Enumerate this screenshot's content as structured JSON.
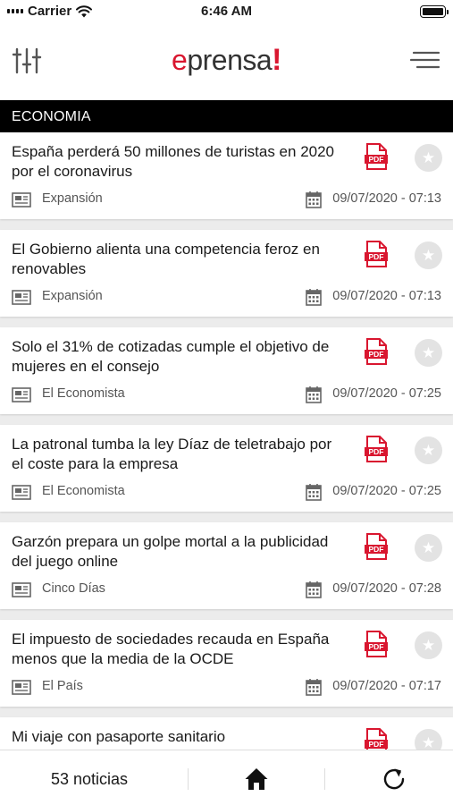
{
  "status_bar": {
    "carrier": "Carrier",
    "time": "6:46 AM"
  },
  "header": {
    "logo_e": "e",
    "logo_rest": "prensa",
    "logo_bang": "!"
  },
  "section": {
    "title": "ECONOMIA"
  },
  "news": [
    {
      "title": "España perderá 50 millones de turistas en 2020 por el coronavirus",
      "source": "Expansión",
      "datetime": "09/07/2020 - 07:13"
    },
    {
      "title": "El Gobierno alienta una competencia feroz en renovables",
      "source": "Expansión",
      "datetime": "09/07/2020 - 07:13"
    },
    {
      "title": "Solo el 31% de cotizadas cumple el objetivo de mujeres en el consejo",
      "source": "El Economista",
      "datetime": "09/07/2020 - 07:25"
    },
    {
      "title": "La patronal tumba la ley Díaz de teletrabajo por el coste para la empresa",
      "source": "El Economista",
      "datetime": "09/07/2020 - 07:25"
    },
    {
      "title": "Garzón prepara un golpe mortal a la publicidad del juego online",
      "source": "Cinco Días",
      "datetime": "09/07/2020 - 07:28"
    },
    {
      "title": "El impuesto de sociedades recauda en España menos que la media de la OCDE",
      "source": "El País",
      "datetime": "09/07/2020 - 07:17"
    },
    {
      "title": "Mi viaje con pasaporte sanitario",
      "source": "",
      "datetime": ""
    }
  ],
  "bottom_bar": {
    "count": "53 noticias"
  },
  "icons": {
    "pdf": "pdf-icon",
    "favorite": "star-icon",
    "source": "newspaper-icon",
    "date": "calendar-icon",
    "home": "home-icon",
    "refresh": "refresh-icon",
    "filter": "sliders-icon",
    "menu": "hamburger-menu-icon"
  },
  "colors": {
    "brand": "#d9162f",
    "section_bg": "#000000"
  }
}
